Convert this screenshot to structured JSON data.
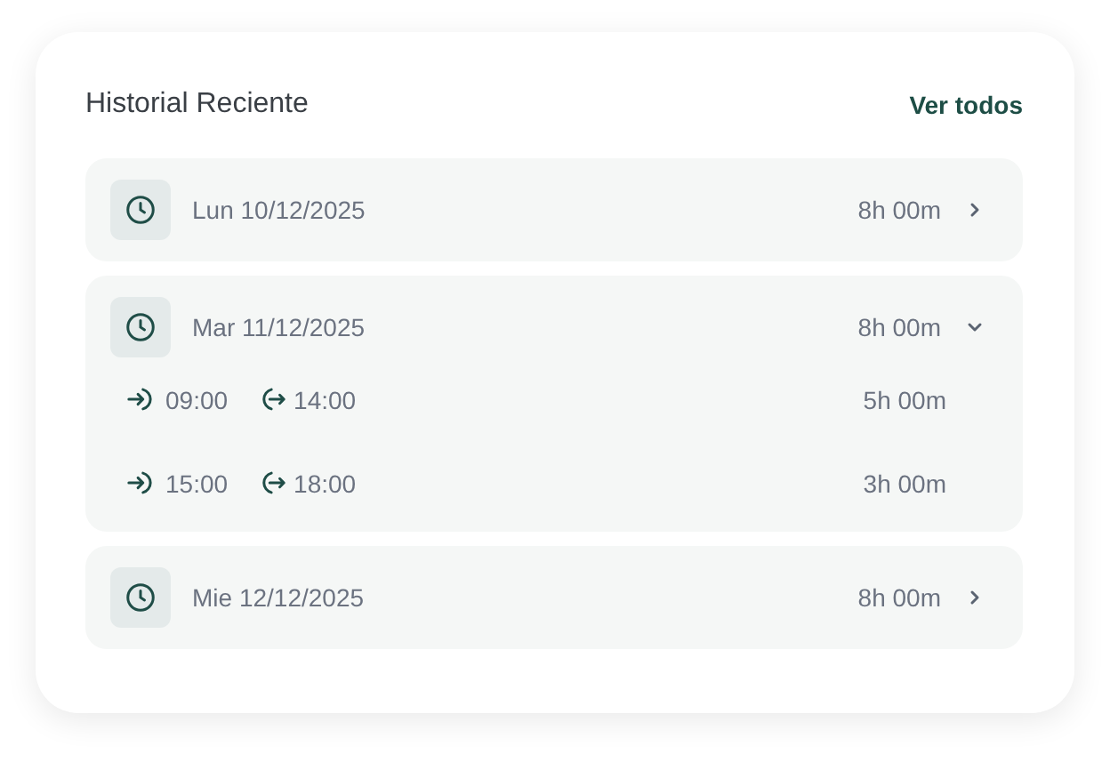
{
  "title": "Historial Reciente",
  "view_all": "Ver todos",
  "days": [
    {
      "date": "Lun 10/12/2025",
      "total": "8h 00m",
      "expanded": false
    },
    {
      "date": "Mar 11/12/2025",
      "total": "8h 00m",
      "expanded": true,
      "sessions": [
        {
          "in": "09:00",
          "out": "14:00",
          "duration": "5h 00m"
        },
        {
          "in": "15:00",
          "out": "18:00",
          "duration": "3h 00m"
        }
      ]
    },
    {
      "date": "Mie 12/12/2025",
      "total": "8h 00m",
      "expanded": false
    }
  ]
}
